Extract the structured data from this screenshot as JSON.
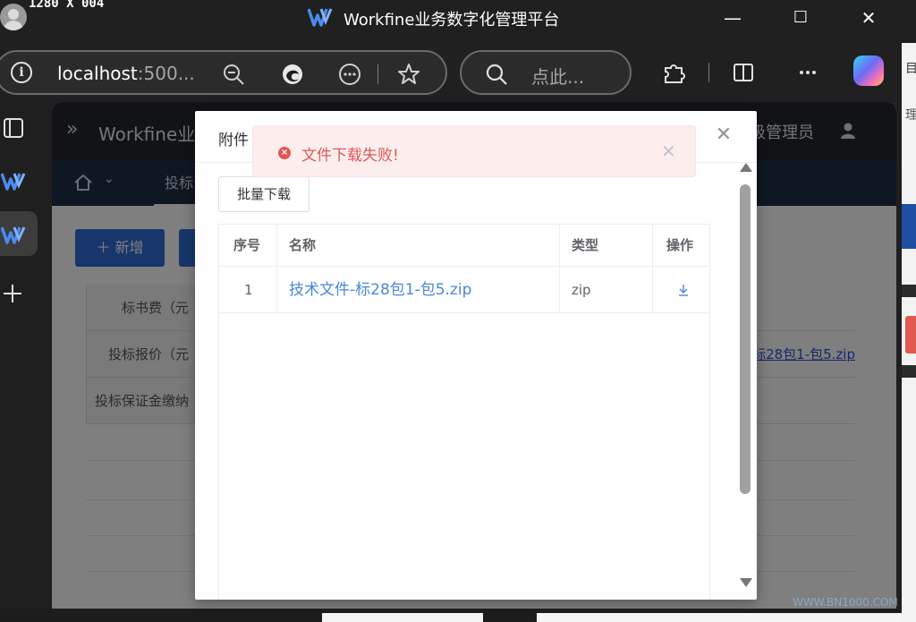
{
  "window": {
    "resolution_text": "1280 X 004",
    "title": "Workfine业务数字化管理平台",
    "controls": {
      "minimize": "—",
      "maximize": "☐",
      "close": "✕"
    }
  },
  "browser": {
    "url_host": "localhost",
    "url_rest": ":500...",
    "search_placeholder": "点此...",
    "icons": [
      "info-icon",
      "zoom-out-icon",
      "edge-logo-icon",
      "more-circle-icon",
      "favorite-star-icon",
      "search-icon",
      "extensions-icon",
      "split-screen-icon",
      "more-icon",
      "copilot-icon"
    ]
  },
  "sidebar": {
    "items": [
      "tabs-icon",
      "workfine-app-icon",
      "workfine-app-icon-active",
      "add-icon"
    ]
  },
  "app": {
    "header_title": "Workfine业务",
    "admin_label": "级管理员",
    "nav_tab": "投标",
    "add_button": "新增",
    "rows": [
      {
        "label": "标书费（元"
      },
      {
        "label": "投标报价（元",
        "link": "标28包1-包5.zip"
      },
      {
        "label": "投标保证金缴纳"
      }
    ]
  },
  "modal": {
    "title": "附件",
    "batch_download": "批量下载",
    "columns": [
      "序号",
      "名称",
      "类型",
      "操作"
    ],
    "rows": [
      {
        "index": "1",
        "name": "技术文件-标28包1-包5.zip",
        "type": "zip"
      }
    ]
  },
  "toast": {
    "message": "文件下载失败!"
  },
  "background_right": {
    "text_top": "目",
    "text_mid": "理"
  },
  "watermark": "WWW.BN1000.COM",
  "colors": {
    "accent": "#2f6fd8",
    "error": "#e05656",
    "link": "#4a87d8"
  }
}
